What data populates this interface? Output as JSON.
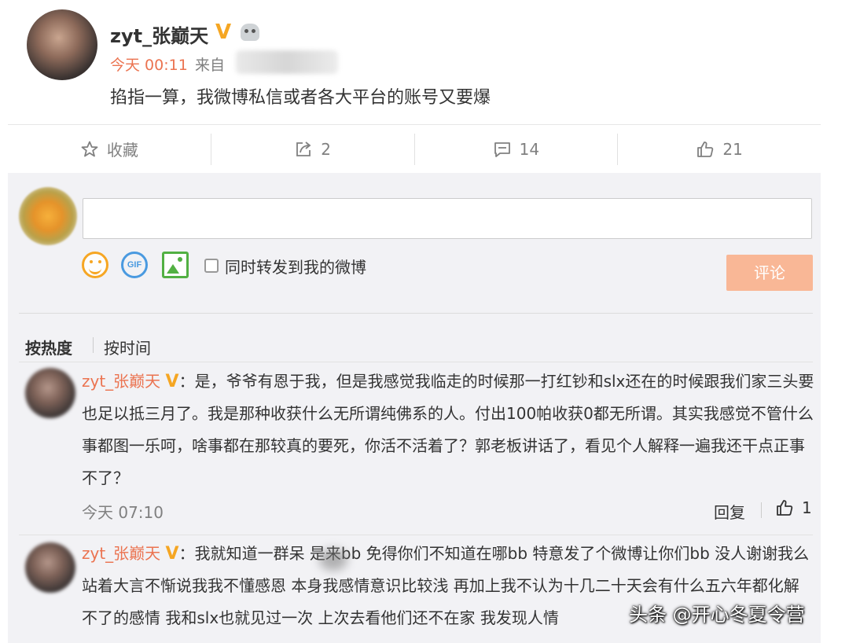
{
  "post": {
    "username": "zyt_张巅天",
    "verified_badge": "V",
    "time": "今天 00:11",
    "source_prefix": "来自",
    "text": "掐指一算，我微博私信或者各大平台的账号又要爆"
  },
  "actions": {
    "favorite": {
      "label": "收藏",
      "icon": "star-icon"
    },
    "repost": {
      "label": "2",
      "icon": "repost-icon"
    },
    "comment": {
      "label": "14",
      "icon": "comment-icon"
    },
    "like": {
      "label": "21",
      "icon": "thumbs-up-icon"
    }
  },
  "composer": {
    "input_value": "",
    "gif_label": "GIF",
    "repost_option": "同时转发到我的微博",
    "submit_label": "评论"
  },
  "sort": {
    "hot": "按热度",
    "time": "按时间"
  },
  "comments": [
    {
      "username": "zyt_张巅天",
      "badge": "V",
      "text": "：是，爷爷有恩于我，但是我感觉我临走的时候那一打红钞和slx还在的时候跟我们家三头要也足以抵三月了。我是那种收获什么无所谓纯佛系的人。付出100帕收获0都无所谓。其实我感觉不管什么事都图一乐呵，啥事都在那较真的要死，你活不活着了？郭老板讲话了，看见个人解释一遍我还干点正事不了？",
      "time": "今天 07:10",
      "reply_label": "回复",
      "likes": "1"
    },
    {
      "username": "zyt_张巅天",
      "badge": "V",
      "text": "：我就知道一群呆 是来bb 免得你们不知道在哪bb 特意发了个微博让你们bb 没人谢谢我么 站着大言不惭说我我不懂感恩 本身我感情意识比较浅 再加上我不认为十几二十天会有什么五六年都化解不了的感情 我和slx也就见过一次 上次去看他们还不在家 我发现人情"
    }
  ],
  "watermark": "头条 @开心冬夏令营",
  "colors": {
    "accent_orange": "#eb7350",
    "verified_gold": "#f5a623",
    "submit_disabled": "#f9b796",
    "comment_bg": "#f2f2f5"
  }
}
